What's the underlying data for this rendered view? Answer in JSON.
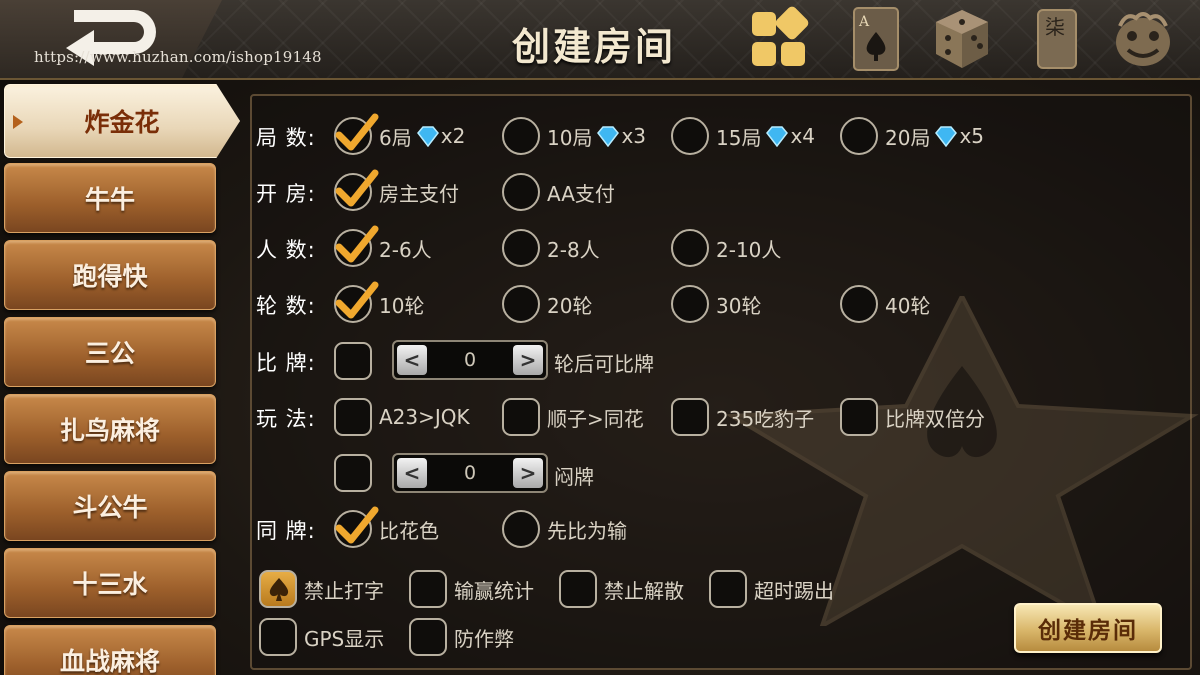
{
  "header": {
    "title": "创建房间",
    "watermark": "https://www.huzhan.com/ishop19148",
    "icons": [
      "grid-icon",
      "card-icon",
      "dice-icon",
      "mahjong-icon",
      "lion-icon"
    ],
    "mahjong_char": "柒",
    "card_char": "A"
  },
  "sidebar": {
    "items": [
      {
        "label": "炸金花",
        "active": true
      },
      {
        "label": "牛牛",
        "active": false
      },
      {
        "label": "跑得快",
        "active": false
      },
      {
        "label": "三公",
        "active": false
      },
      {
        "label": "扎鸟麻将",
        "active": false
      },
      {
        "label": "斗公牛",
        "active": false
      },
      {
        "label": "十三水",
        "active": false
      },
      {
        "label": "血战麻将",
        "active": false
      }
    ]
  },
  "rows": {
    "rounds": {
      "label": "局 数:",
      "options": [
        {
          "text": "6局",
          "gem": "x2",
          "checked": true
        },
        {
          "text": "10局",
          "gem": "x3",
          "checked": false
        },
        {
          "text": "15局",
          "gem": "x4",
          "checked": false
        },
        {
          "text": "20局",
          "gem": "x5",
          "checked": false
        }
      ]
    },
    "open": {
      "label": "开 房:",
      "options": [
        {
          "text": "房主支付",
          "checked": true
        },
        {
          "text": "AA支付",
          "checked": false
        }
      ]
    },
    "players": {
      "label": "人 数:",
      "options": [
        {
          "text": "2-6人",
          "checked": true
        },
        {
          "text": "2-8人",
          "checked": false
        },
        {
          "text": "2-10人",
          "checked": false
        }
      ]
    },
    "turns": {
      "label": "轮 数:",
      "options": [
        {
          "text": "10轮",
          "checked": true
        },
        {
          "text": "20轮",
          "checked": false
        },
        {
          "text": "30轮",
          "checked": false
        },
        {
          "text": "40轮",
          "checked": false
        }
      ]
    },
    "compare": {
      "label": "比 牌:",
      "stepper_value": "0",
      "suffix": "轮后可比牌"
    },
    "play": {
      "label": "玩 法:",
      "options": [
        {
          "text": "A23>JQK",
          "checked": false
        },
        {
          "text": "顺子>同花",
          "checked": false
        },
        {
          "text": "235吃豹子",
          "checked": false
        },
        {
          "text": "比牌双倍分",
          "checked": false
        }
      ]
    },
    "blind": {
      "stepper_value": "0",
      "suffix": "闷牌"
    },
    "same": {
      "label": "同 牌:",
      "options": [
        {
          "text": "比花色",
          "checked": true
        },
        {
          "text": "先比为输",
          "checked": false
        }
      ]
    },
    "extras": [
      {
        "text": "禁止打字",
        "checked": true
      },
      {
        "text": "输赢统计",
        "checked": false
      },
      {
        "text": "禁止解散",
        "checked": false
      },
      {
        "text": "超时踢出",
        "checked": false
      },
      {
        "text": "GPS显示",
        "checked": false
      },
      {
        "text": "防作弊",
        "checked": false
      }
    ]
  },
  "stepper": {
    "left": "<",
    "right": ">"
  },
  "create_button": "创建房间",
  "colors": {
    "check": "#f0a82e",
    "accent": "#c8894a",
    "gold": "#d9b66a"
  }
}
